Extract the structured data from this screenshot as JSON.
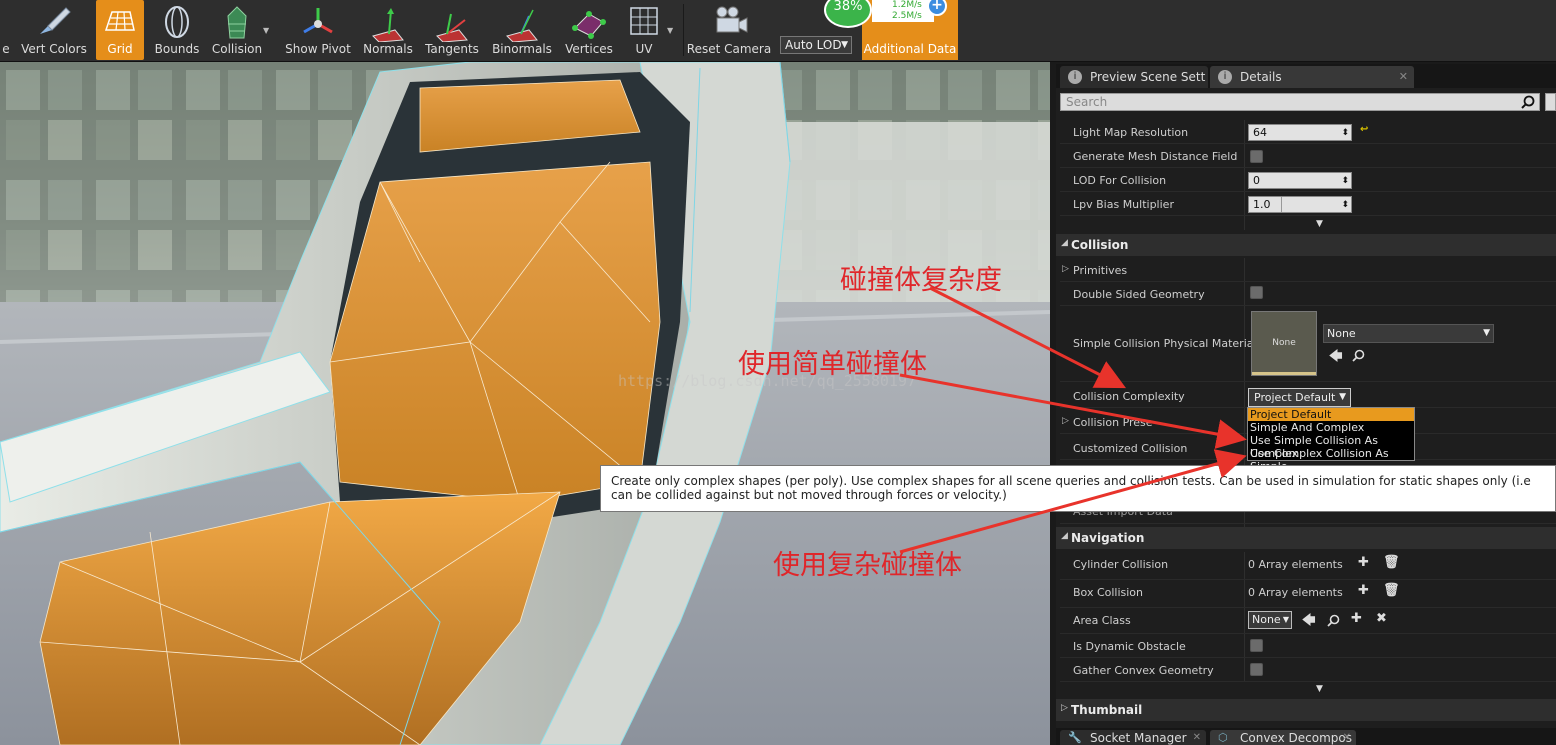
{
  "toolbar": {
    "items": [
      {
        "label": "e"
      },
      {
        "label": "Vert Colors"
      },
      {
        "label": "Grid",
        "active": true
      },
      {
        "label": "Bounds"
      },
      {
        "label": "Collision"
      },
      {
        "label": "Show Pivot"
      },
      {
        "label": "Normals"
      },
      {
        "label": "Tangents"
      },
      {
        "label": "Binormals"
      },
      {
        "label": "Vertices"
      },
      {
        "label": "UV"
      },
      {
        "label": "Reset Camera"
      }
    ],
    "auto_lod": "Auto LOD",
    "additional_data": "Additional Data",
    "accent_color": "#e58e1a"
  },
  "overlay": {
    "percent": "38%",
    "net_up": "1.2M/s",
    "net_down": "2.5M/s",
    "plus": "+"
  },
  "annotations": {
    "complexity": "碰撞体复杂度",
    "simple": "使用简单碰撞体",
    "complex": "使用复杂碰撞体",
    "watermark": "https://blog.csdn.net/qq_25580197",
    "color": "#e0262a"
  },
  "panel": {
    "tabs": [
      {
        "label": "Preview Scene Sett",
        "icon": "i"
      },
      {
        "label": "Details",
        "icon": "i"
      }
    ],
    "search_placeholder": "Search",
    "general": {
      "light_map_resolution_label": "Light Map Resolution",
      "light_map_resolution": "64",
      "mesh_distance_field_label": "Generate Mesh Distance Field",
      "lod_for_collision_label": "LOD For Collision",
      "lod_for_collision": "0",
      "lpv_bias_label": "Lpv Bias Multiplier",
      "lpv_bias": "1.0"
    },
    "collision": {
      "title": "Collision",
      "primitives": "Primitives",
      "double_sided": "Double Sided Geometry",
      "simple_phys_material": "Simple Collision Physical Material",
      "material_thumb": "None",
      "material_value": "None",
      "complexity_label": "Collision Complexity",
      "complexity_value": "Project Default",
      "options": [
        "Project Default",
        "Simple And Complex",
        "Use Simple Collision As Complex",
        "Use Complex Collision As Simple"
      ],
      "presets": "Collision Prese",
      "customized": "Customized Collision",
      "asset_import": "Asset Import Data"
    },
    "tooltip": "Create only complex shapes (per poly). Use complex shapes for all scene queries and collision tests. Can be used in simulation for static shapes only (i.e can be collided against but not moved through forces or velocity.)",
    "navigation": {
      "title": "Navigation",
      "cylinder": "Cylinder Collision",
      "cylinder_value": "0 Array elements",
      "box": "Box Collision",
      "box_value": "0 Array elements",
      "area_class": "Area Class",
      "area_class_value": "None",
      "dynamic_obstacle": "Is Dynamic Obstacle",
      "gather_convex": "Gather Convex Geometry"
    },
    "thumbnail": "Thumbnail",
    "bottom_tabs": [
      "Socket Manager",
      "Convex Decompos"
    ]
  }
}
